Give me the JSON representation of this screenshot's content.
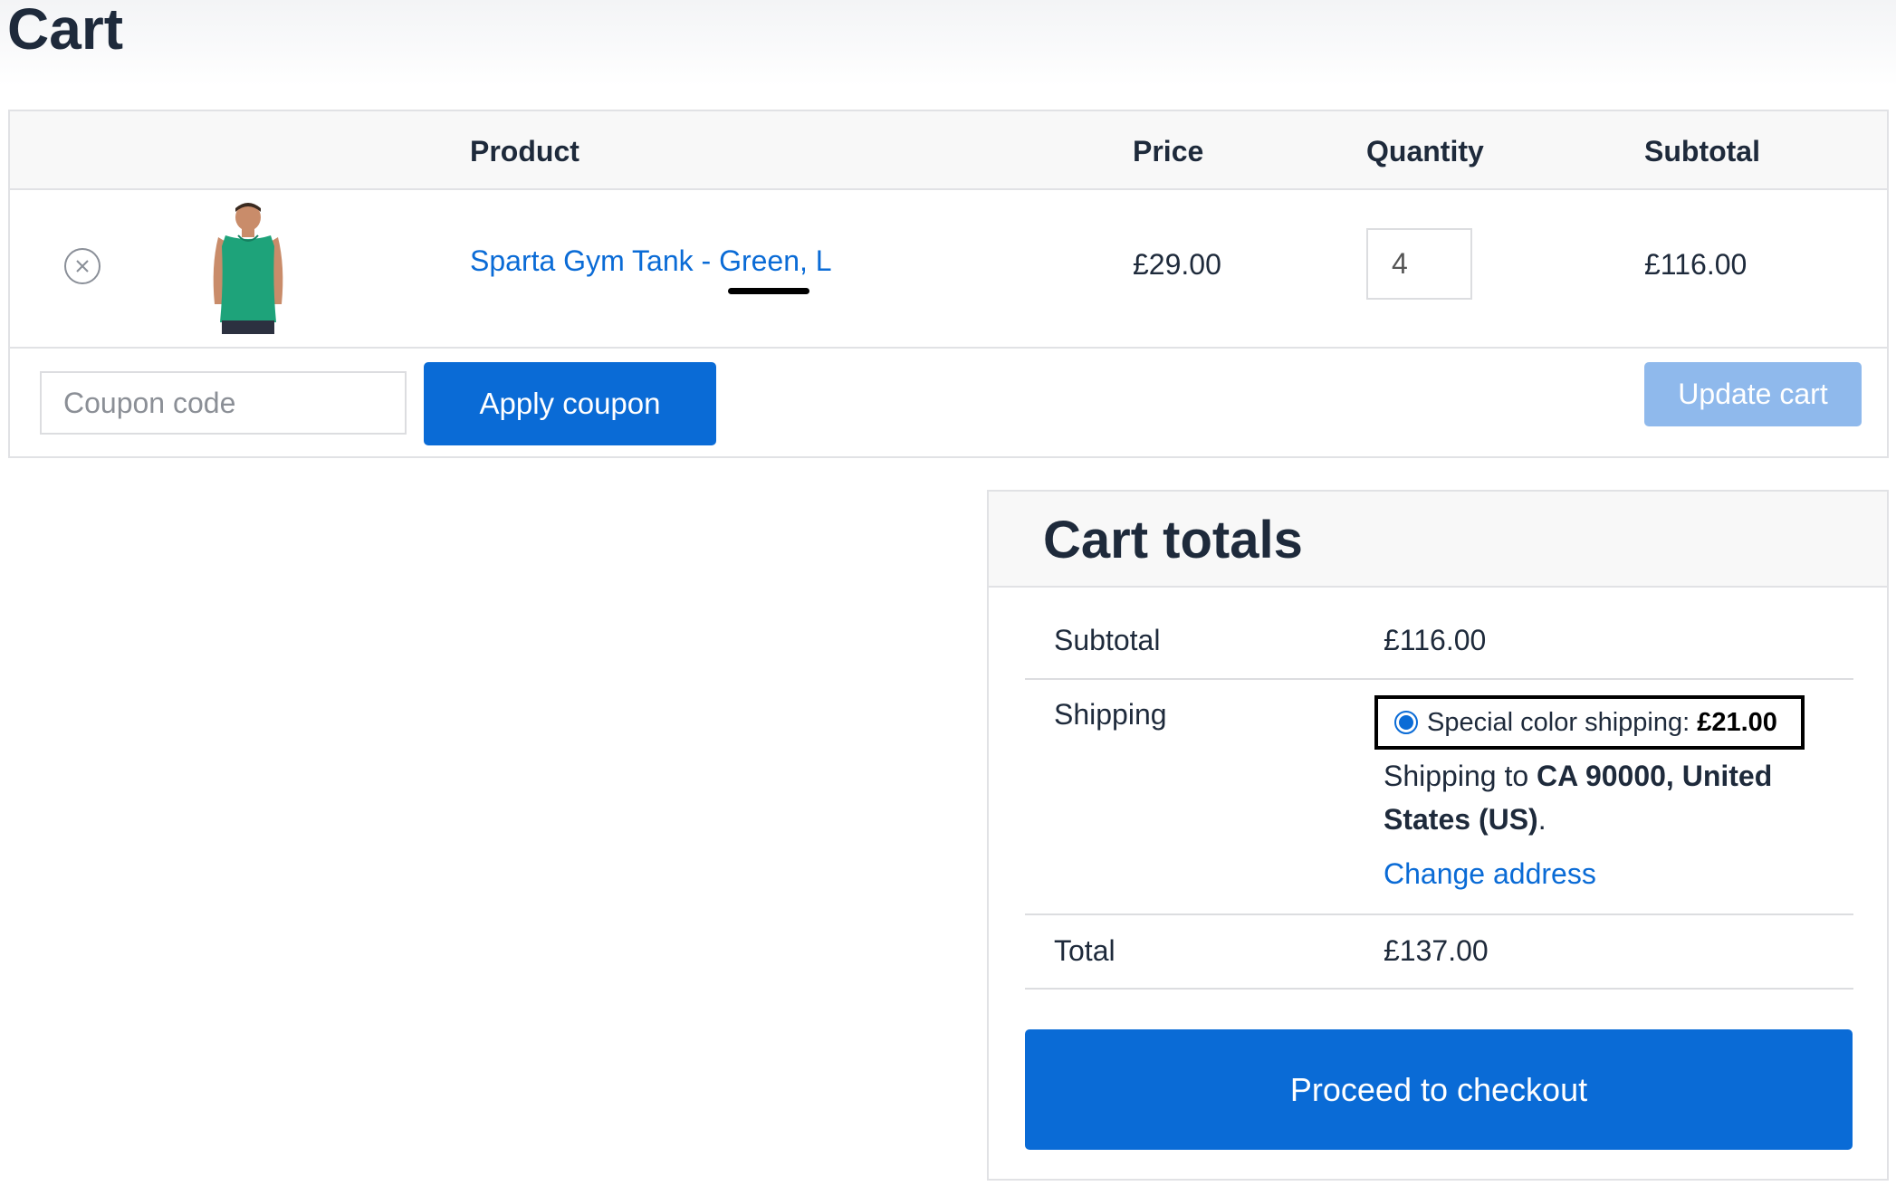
{
  "page": {
    "title": "Cart"
  },
  "cart_table": {
    "headers": {
      "product": "Product",
      "price": "Price",
      "quantity": "Quantity",
      "subtotal": "Subtotal"
    },
    "items": [
      {
        "product_name": "Sparta Gym Tank - Green, L",
        "price": "£29.00",
        "quantity": "4",
        "subtotal": "£116.00",
        "thumbnail_color": "#1ea37a"
      }
    ]
  },
  "coupon": {
    "placeholder": "Coupon code",
    "apply_label": "Apply coupon"
  },
  "update_cart_label": "Update cart",
  "totals": {
    "title": "Cart totals",
    "subtotal_label": "Subtotal",
    "subtotal_value": "£116.00",
    "shipping_label": "Shipping",
    "shipping_option_label": "Special color shipping: ",
    "shipping_option_price": "£21.00",
    "shipping_to_prefix": "Shipping to ",
    "shipping_destination": "CA 90000, United States (US)",
    "shipping_to_suffix": ".",
    "change_address_label": "Change address",
    "total_label": "Total",
    "total_value": "£137.00",
    "checkout_label": "Proceed to checkout"
  },
  "colors": {
    "accent": "#0a6bd6",
    "accent_disabled": "#8fb9ec",
    "text": "#1e2a3b",
    "border": "#e1e2e5"
  },
  "icons": {
    "remove": "remove-circle-x-icon"
  }
}
